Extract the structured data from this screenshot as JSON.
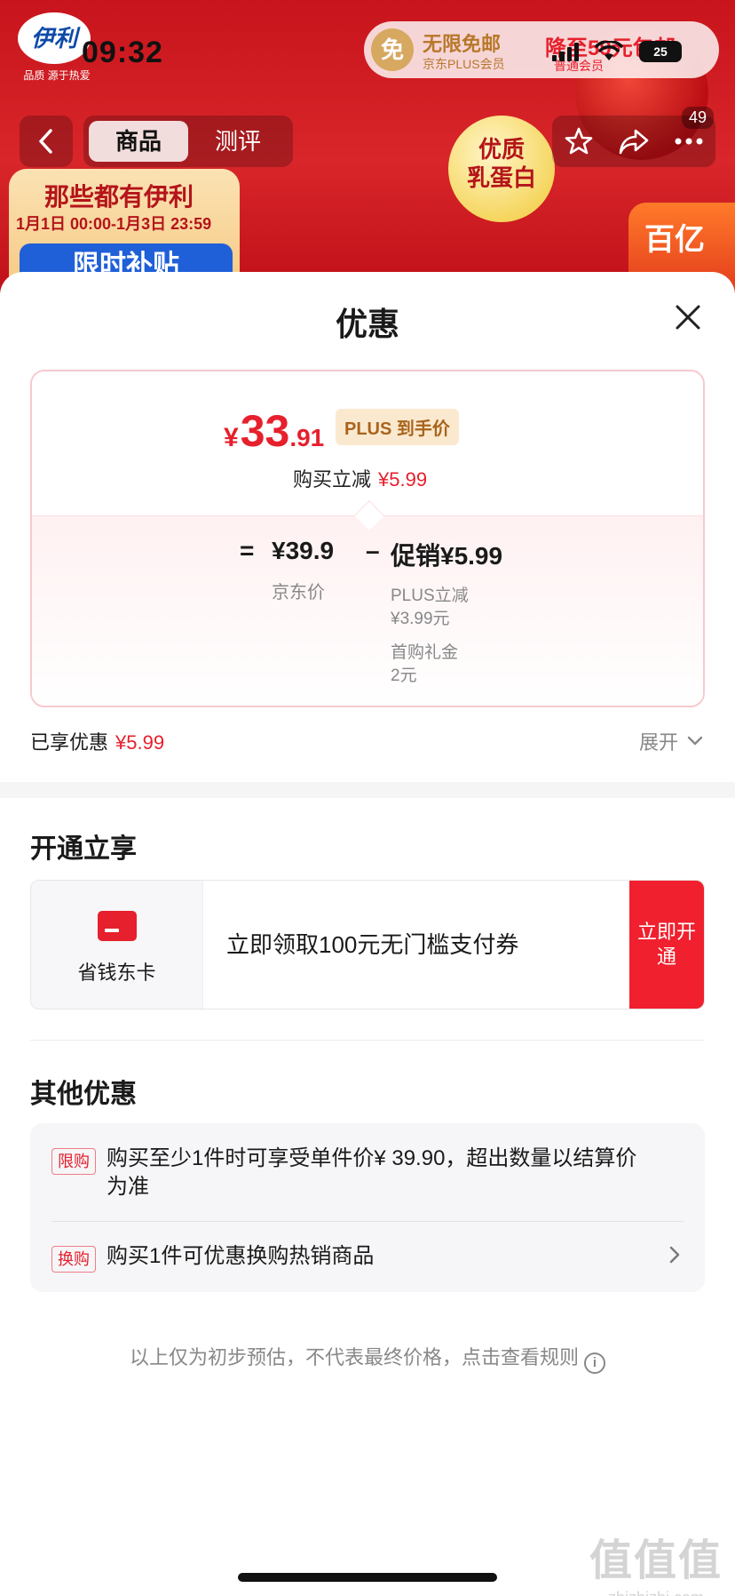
{
  "status": {
    "time": "09:32",
    "battery": "25"
  },
  "banner": {
    "logo_text": "伊利",
    "logo_slogan": "品质 源于热爱",
    "plus_promo": {
      "free": "免",
      "title": "无限免邮",
      "sub": "京东PLUS会员",
      "right_title": "降至59元包邮",
      "right_sub": "普通会员"
    },
    "pill_left": {
      "line1": "那些都有伊利",
      "line2": "1月1日 00:00-1月3日 23:59",
      "line3": "限时补贴"
    },
    "egg": {
      "line1": "优质",
      "line2": "乳蛋白"
    },
    "subsidy": "百亿"
  },
  "nav": {
    "tabs": [
      {
        "label": "商品"
      },
      {
        "label": "测评"
      }
    ],
    "message_count": "49"
  },
  "sheet": {
    "title": "优惠",
    "final_price": {
      "yen": "¥",
      "int": "33",
      "dec": ".91",
      "tag": "PLUS 到手价"
    },
    "reduce": {
      "label": "购买立减",
      "amount": "¥5.99"
    },
    "formula": {
      "eq": "=",
      "base_value": "¥39.9",
      "base_label": "京东价",
      "minus": "–",
      "promo_value": "促销¥5.99",
      "promo_items": [
        "PLUS立减\n¥3.99元",
        "首购礼金\n2元"
      ]
    },
    "enjoyed": {
      "label": "已享优惠",
      "amount": "¥5.99"
    },
    "expand_label": "展开",
    "open_section": {
      "heading": "开通立享",
      "card_name": "省钱东卡",
      "card_text": "立即领取100元无门槛支付券",
      "button": "立即开通"
    },
    "other_section": {
      "heading": "其他优惠",
      "offers": [
        {
          "tag": "限购",
          "text": "购买至少1件时可享受单件价¥ 39.90，超出数量以结算价为准"
        },
        {
          "tag": "换购",
          "text": "购买1件可优惠换购热销商品"
        }
      ]
    },
    "footnote": "以上仅为初步预估，不代表最终价格，点击查看规则",
    "info_icon": "i"
  },
  "watermark": {
    "big": "值值值",
    "small": "zhizhizhi.com"
  },
  "colors": {
    "accent": "#e6202c",
    "plus_gold": "#a8641d",
    "banner_red": "#c8141c"
  }
}
